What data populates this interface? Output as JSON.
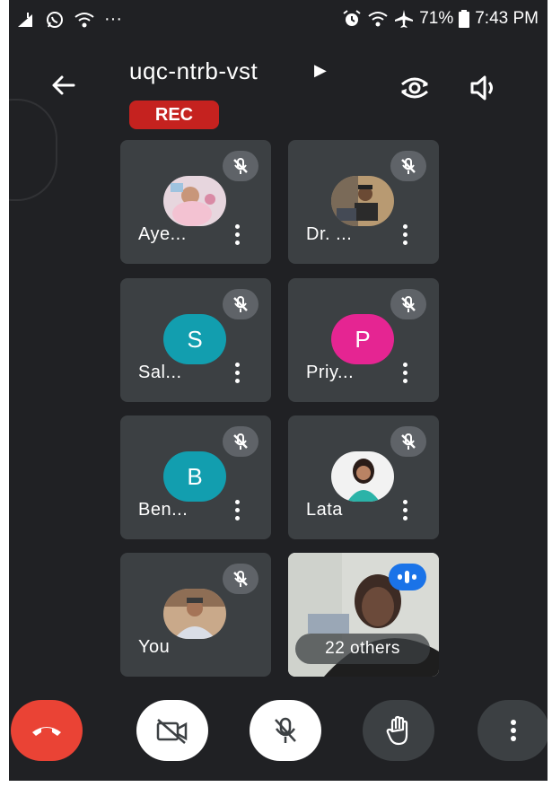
{
  "status_bar": {
    "battery": "71%",
    "time": "7:43 PM",
    "overflow": "···"
  },
  "meeting": {
    "title": "uqc-ntrb-vst",
    "rec_label": "REC"
  },
  "participants": [
    {
      "name": "Aye...",
      "avatar": "photo"
    },
    {
      "name": "Dr. ...",
      "avatar": "photo"
    },
    {
      "name": "Sal...",
      "initial": "S",
      "color": "#129eaf"
    },
    {
      "name": "Priy...",
      "initial": "P",
      "color": "#e52592"
    },
    {
      "name": "Ben...",
      "initial": "B",
      "color": "#129eaf"
    },
    {
      "name": "Lata",
      "avatar": "photo"
    },
    {
      "name": "You",
      "avatar": "photo"
    }
  ],
  "others_tile": {
    "label": "22 others"
  },
  "controls": [
    "end-call",
    "camera-off",
    "mic-off",
    "raise-hand",
    "more-options"
  ],
  "colors": {
    "background": "#202124",
    "tile": "#3c4043",
    "rec": "#c5221f",
    "end_call": "#ea4335",
    "speaking": "#1a73e8"
  }
}
